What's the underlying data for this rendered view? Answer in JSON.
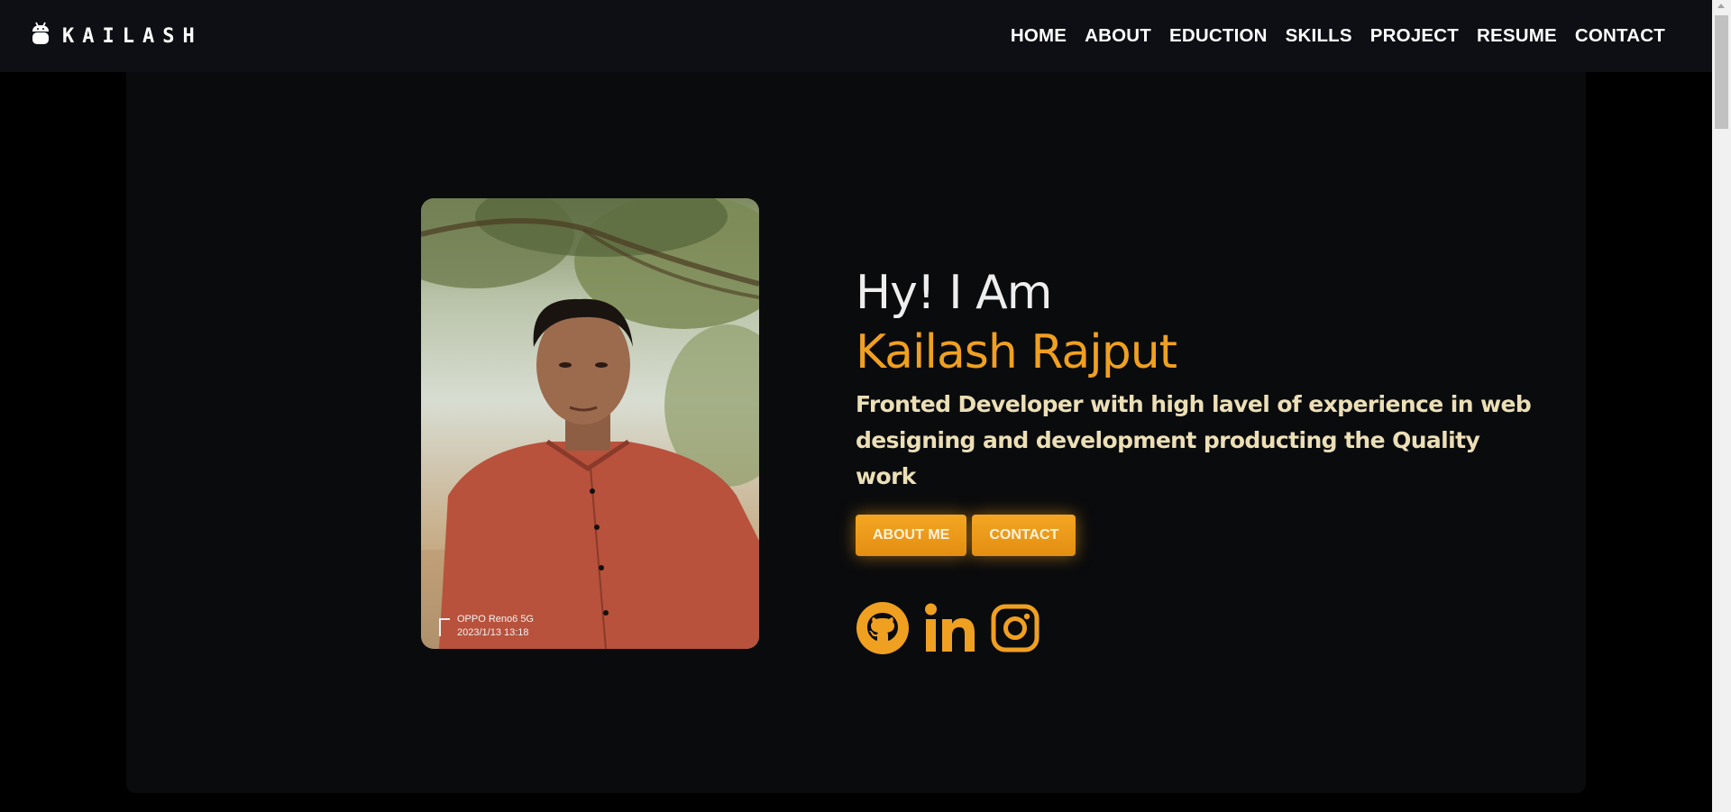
{
  "brand": {
    "name": "KAILASH",
    "icon": "android-icon"
  },
  "nav": {
    "items": [
      "HOME",
      "ABOUT",
      "EDUCTION",
      "SKILLS",
      "PROJECT",
      "RESUME",
      "CONTACT"
    ]
  },
  "hero": {
    "photo_caption": {
      "line1": "OPPO Reno6 5G",
      "line2": "2023/1/13 13:18"
    },
    "greeting": "Hy! I Am",
    "name": "Kailash Rajput",
    "tagline": "Fronted Developer with high lavel of experience in web designing and development producting the Quality work",
    "buttons": {
      "about": "ABOUT ME",
      "contact": "CONTACT"
    },
    "socials": [
      "github-icon",
      "linkedin-icon",
      "instagram-icon"
    ]
  },
  "colors": {
    "accent": "#f0a020",
    "background": "#000000",
    "card": "#0a0b0d",
    "navbar": "#0d0f14",
    "tagline": "#ecdfb6"
  }
}
